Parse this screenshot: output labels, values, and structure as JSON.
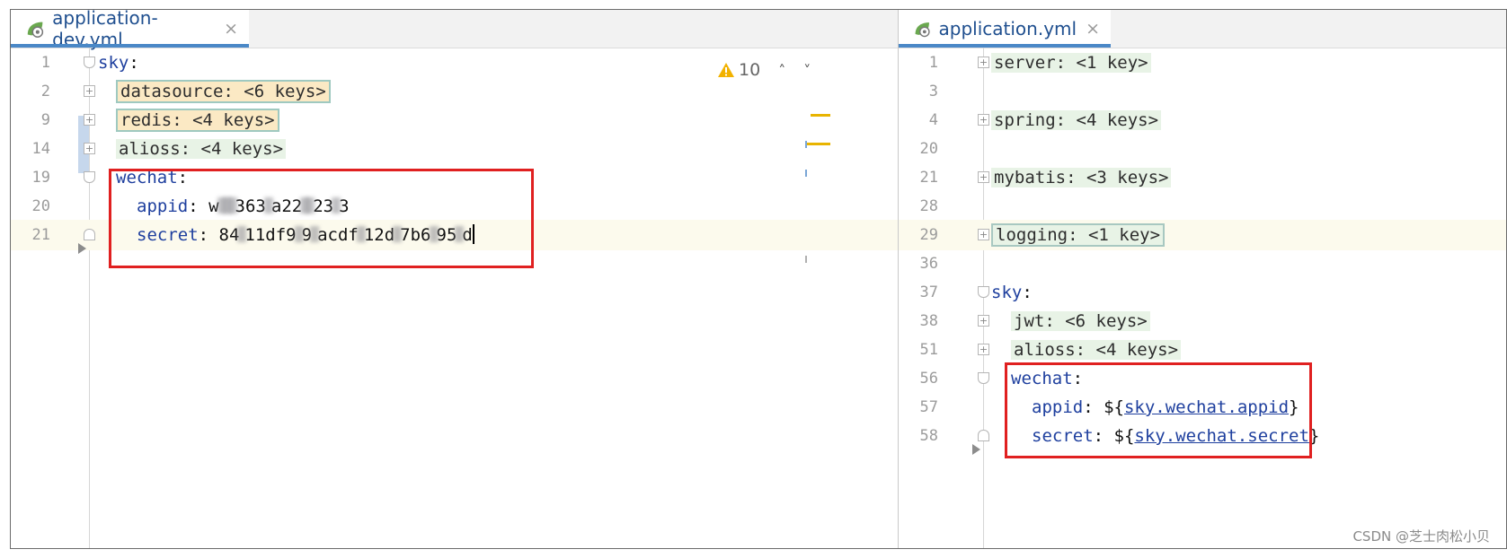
{
  "left_editor": {
    "tab_title": "application-dev.yml",
    "tab_close": "×",
    "inspection_count": "10",
    "lines": [
      {
        "no": "1",
        "key": "sky",
        "sep": ":"
      },
      {
        "no": "2",
        "folded": "datasource: <6 keys>"
      },
      {
        "no": "9",
        "folded": "redis: <4 keys>"
      },
      {
        "no": "14",
        "folded": "alioss: <4 keys>"
      },
      {
        "no": "19",
        "key": "wechat",
        "sep": ":"
      },
      {
        "no": "20",
        "key": "appid",
        "sep": ": ",
        "value": "w",
        "v2": "363",
        "v3": "a22",
        "v4": "23",
        "v5": "3"
      },
      {
        "no": "21",
        "key": "secret",
        "sep": ": ",
        "value": "84",
        "v2": "11df9",
        "v3": "9",
        "v4": "acdf",
        "v5": "12d",
        "v6": "7b6",
        "v7": "95",
        "v8": "d"
      }
    ]
  },
  "right_editor": {
    "tab_title": "application.yml",
    "tab_close": "×",
    "lines": [
      {
        "no": "1",
        "folded": "server: <1 key>"
      },
      {
        "no": "3"
      },
      {
        "no": "4",
        "folded": "spring: <4 keys>"
      },
      {
        "no": "20"
      },
      {
        "no": "21",
        "folded": "mybatis: <3 keys>"
      },
      {
        "no": "28"
      },
      {
        "no": "29",
        "folded": "logging: <1 key>"
      },
      {
        "no": "36"
      },
      {
        "no": "37",
        "key": "sky",
        "sep": ":"
      },
      {
        "no": "38",
        "folded": "jwt: <6 keys>"
      },
      {
        "no": "51",
        "folded": "alioss: <4 keys>"
      },
      {
        "no": "56",
        "key": "wechat",
        "sep": ":"
      },
      {
        "no": "57",
        "key": "appid",
        "sep": ": ",
        "pre": "${",
        "ref": "sky.wechat.appid",
        "post": "}"
      },
      {
        "no": "58",
        "key": "secret",
        "sep": ": ",
        "pre": "${",
        "ref": "sky.wechat.secret",
        "post": "}"
      }
    ]
  },
  "watermark": "CSDN @芝士肉松小贝",
  "colors": {
    "tab_underline": "#4a88c7",
    "highlight_box": "#e02020",
    "yaml_key": "#1e3f9e",
    "warning": "#f2b200"
  },
  "icons": {
    "tab_icon": "spring-leaf-icon",
    "warning": "warning-triangle-icon",
    "prev": "chevron-up-icon",
    "next": "chevron-down-icon"
  }
}
